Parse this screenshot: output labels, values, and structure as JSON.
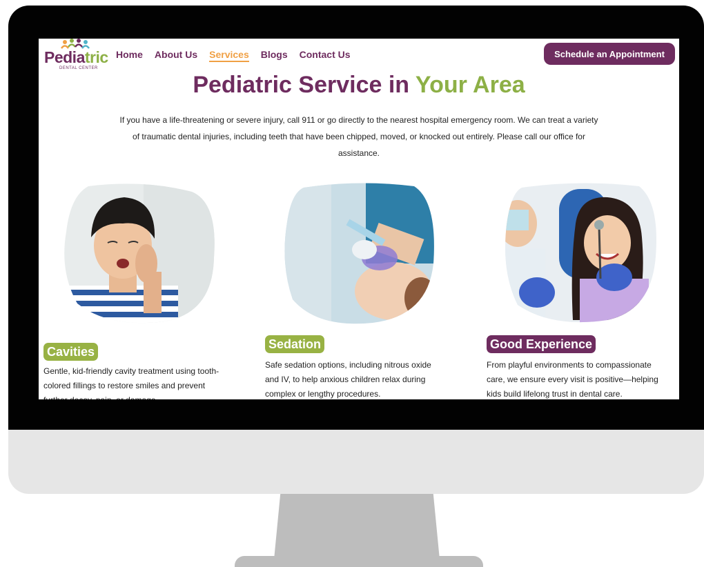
{
  "logo": {
    "name_part1": "Pedia",
    "name_part2": "tric",
    "subtitle": "DENTAL CENTER"
  },
  "nav": {
    "items": [
      "Home",
      "About Us",
      "Services",
      "Blogs",
      "Contact Us"
    ],
    "active": "Services"
  },
  "cta": {
    "label": "Schedule an Appointment"
  },
  "hero": {
    "title_part1": "Pediatric Service in",
    "title_part2": "Your Area",
    "text": "If you have a life-threatening or severe injury, call 911 or go directly to the nearest hospital emergency room. We can treat a variety of traumatic dental injuries, including teeth that have been chipped, moved, or knocked out entirely. Please call our office for assistance."
  },
  "services": [
    {
      "title": "Cavities",
      "text": "Gentle, kid-friendly cavity treatment using tooth-colored fillings to restore smiles and prevent further decay, pain, or damage."
    },
    {
      "title": "Sedation",
      "text": "Safe sedation options, including nitrous oxide and IV, to help anxious children relax during complex or lengthy procedures."
    },
    {
      "title": "Good Experience",
      "text": "From playful environments to compassionate care, we ensure every visit is positive—helping kids build lifelong trust in dental care."
    }
  ],
  "colors": {
    "brand_purple": "#6e2c5f",
    "brand_green": "#8db046",
    "active_nav": "#f0a044"
  }
}
